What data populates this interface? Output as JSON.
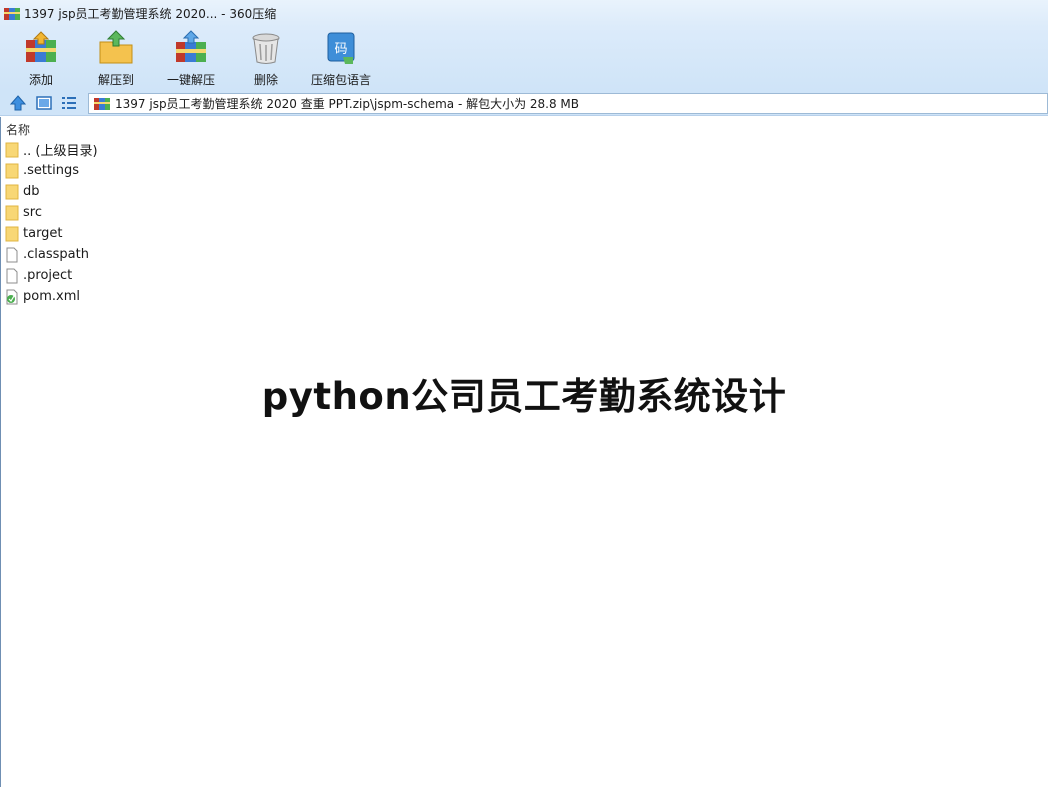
{
  "window": {
    "title": "1397 jsp员工考勤管理系统 2020... - 360压缩"
  },
  "toolbar": {
    "items": [
      {
        "label": "添加",
        "icon": "add-archive-icon"
      },
      {
        "label": "解压到",
        "icon": "extract-to-icon"
      },
      {
        "label": "一键解压",
        "icon": "one-click-extract-icon"
      },
      {
        "label": "删除",
        "icon": "delete-bin-icon"
      },
      {
        "label": "压缩包语言",
        "icon": "archive-language-icon"
      }
    ]
  },
  "address": {
    "path": "1397 jsp员工考勤管理系统 2020 查重 PPT.zip\\jspm-schema - 解包大小为 28.8 MB"
  },
  "filelist": {
    "header": "名称",
    "items": [
      {
        "name": ".. (上级目录)",
        "type": "folder"
      },
      {
        "name": ".settings",
        "type": "folder"
      },
      {
        "name": "db",
        "type": "folder"
      },
      {
        "name": "src",
        "type": "folder"
      },
      {
        "name": "target",
        "type": "folder"
      },
      {
        "name": ".classpath",
        "type": "file"
      },
      {
        "name": ".project",
        "type": "file"
      },
      {
        "name": "pom.xml",
        "type": "xml"
      }
    ]
  },
  "overlay": {
    "text": "python公司员工考勤系统设计"
  }
}
